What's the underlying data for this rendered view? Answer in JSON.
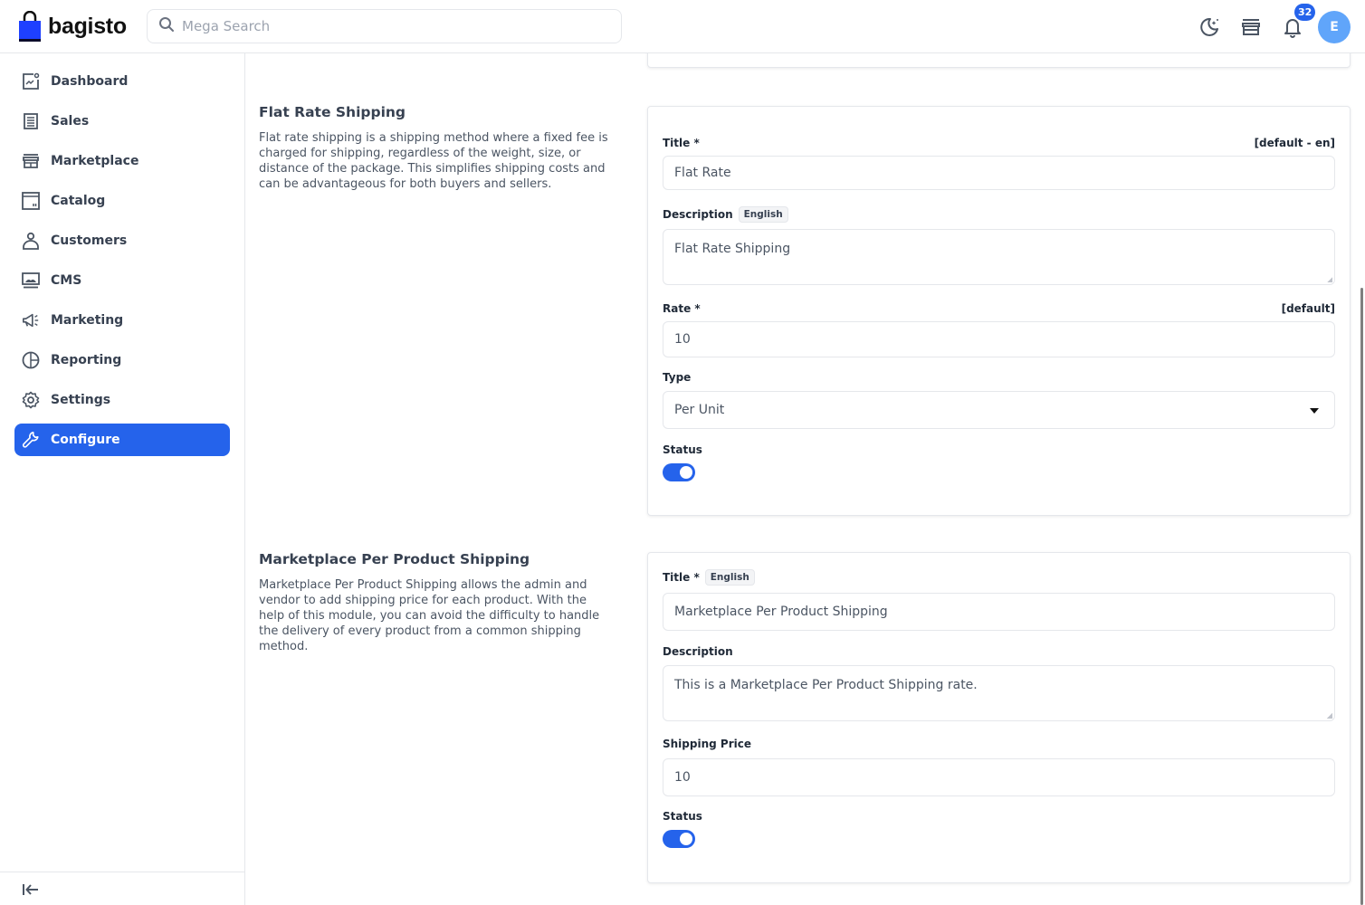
{
  "header": {
    "logo_text": "bagisto",
    "search_placeholder": "Mega Search",
    "notification_count": "32",
    "avatar_initial": "E"
  },
  "sidebar": {
    "items": [
      {
        "label": "Dashboard",
        "icon": "dashboard-icon",
        "active": false
      },
      {
        "label": "Sales",
        "icon": "sales-icon",
        "active": false
      },
      {
        "label": "Marketplace",
        "icon": "marketplace-icon",
        "active": false
      },
      {
        "label": "Catalog",
        "icon": "catalog-icon",
        "active": false
      },
      {
        "label": "Customers",
        "icon": "customers-icon",
        "active": false
      },
      {
        "label": "CMS",
        "icon": "cms-icon",
        "active": false
      },
      {
        "label": "Marketing",
        "icon": "marketing-icon",
        "active": false
      },
      {
        "label": "Reporting",
        "icon": "reporting-icon",
        "active": false
      },
      {
        "label": "Settings",
        "icon": "settings-icon",
        "active": false
      },
      {
        "label": "Configure",
        "icon": "configure-icon",
        "active": true
      }
    ]
  },
  "flat_rate": {
    "title": "Flat Rate Shipping",
    "description": "Flat rate shipping is a shipping method where a fixed fee is charged for shipping, regardless of the weight, size, or distance of the package. This simplifies shipping costs and can be advantageous for both buyers and sellers.",
    "fields": {
      "title_label": "Title *",
      "title_scope": "[default - en]",
      "title_value": "Flat Rate",
      "description_label": "Description",
      "description_lang": "English",
      "description_value": "Flat Rate Shipping",
      "rate_label": "Rate *",
      "rate_scope": "[default]",
      "rate_value": "10",
      "type_label": "Type",
      "type_value": "Per Unit",
      "status_label": "Status",
      "status_enabled": true
    }
  },
  "per_product": {
    "title": "Marketplace Per Product Shipping",
    "description": "Marketplace Per Product Shipping allows the admin and vendor to add shipping price for each product. With the help of this module, you can avoid the difficulty to handle the delivery of every product from a common shipping method.",
    "fields": {
      "title_label": "Title *",
      "title_lang": "English",
      "title_value": "Marketplace Per Product Shipping",
      "description_label": "Description",
      "description_value": "This is a Marketplace Per Product Shipping rate.",
      "shipping_price_label": "Shipping Price",
      "shipping_price_value": "10",
      "status_label": "Status",
      "status_enabled": true
    }
  },
  "colors": {
    "accent": "#2563eb",
    "avatar": "#60a5fa"
  }
}
